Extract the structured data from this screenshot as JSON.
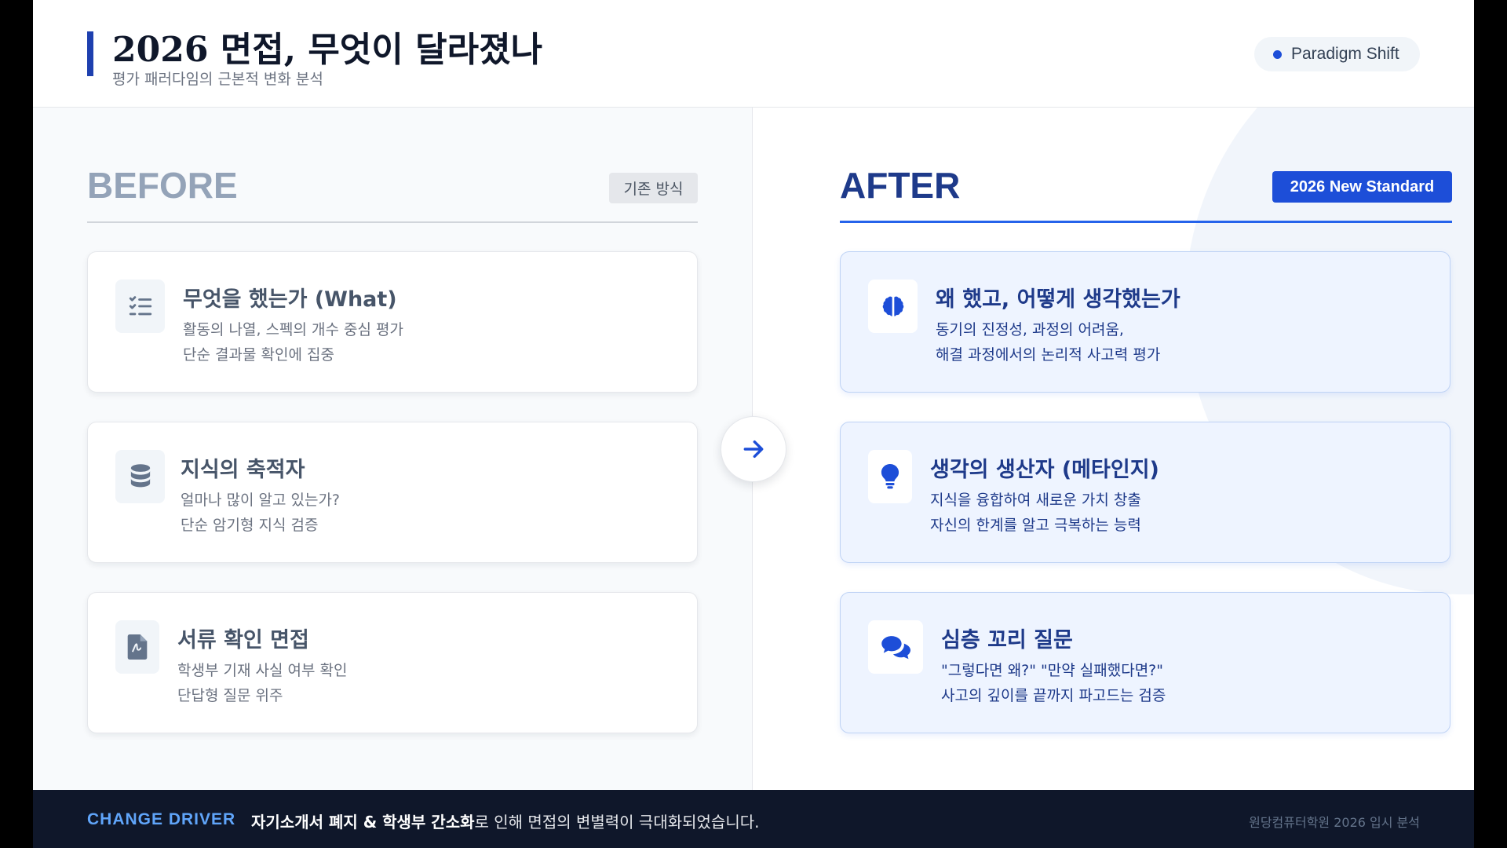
{
  "header": {
    "title": "2026 면접, 무엇이 달라졌나",
    "subtitle": "평가 패러다임의 근본적 변화 분석",
    "badge": "Paradigm Shift"
  },
  "before": {
    "heading": "BEFORE",
    "tag": "기존 방식",
    "cards": [
      {
        "icon": "checklist-icon",
        "title": "무엇을 했는가 (What)",
        "line1": "활동의 나열, 스펙의 개수 중심 평가",
        "line2": "단순 결과물 확인에 집중"
      },
      {
        "icon": "database-icon",
        "title": "지식의 축적자",
        "line1": "얼마나 많이 알고 있는가?",
        "line2": "단순 암기형 지식 검증"
      },
      {
        "icon": "document-icon",
        "title": "서류 확인 면접",
        "line1": "학생부 기재 사실 여부 확인",
        "line2": "단답형 질문 위주"
      }
    ]
  },
  "after": {
    "heading": "AFTER",
    "tag": "2026 New Standard",
    "cards": [
      {
        "icon": "brain-icon",
        "title": "왜 했고, 어떻게 생각했는가",
        "line1": "동기의 진정성, 과정의 어려움,",
        "line2": "해결 과정에서의 논리적 사고력 평가"
      },
      {
        "icon": "lightbulb-icon",
        "title": "생각의 생산자 (메타인지)",
        "line1": "지식을 융합하여 새로운 가치 창출",
        "line2": "자신의 한계를 알고 극복하는 능력"
      },
      {
        "icon": "chat-bubbles-icon",
        "title": "심층 꼬리 질문",
        "line1": "\"그렇다면 왜?\" \"만약 실패했다면?\"",
        "line2": "사고의 깊이를 끝까지 파고드는 검증"
      }
    ]
  },
  "transition_icon": "arrow-right-icon",
  "footer": {
    "label": "CHANGE DRIVER",
    "message_bold": "자기소개서 폐지 & 학생부 간소화",
    "message_rest": "로 인해 면접의 변별력이 극대화되었습니다.",
    "credit": "원당컴퓨터학원 2026 입시 분석"
  },
  "colors": {
    "accent": "#1d4ed8",
    "navy": "#1e3a8a",
    "footer_bg": "#0f172a",
    "after_card_bg": "#eef4ff"
  }
}
